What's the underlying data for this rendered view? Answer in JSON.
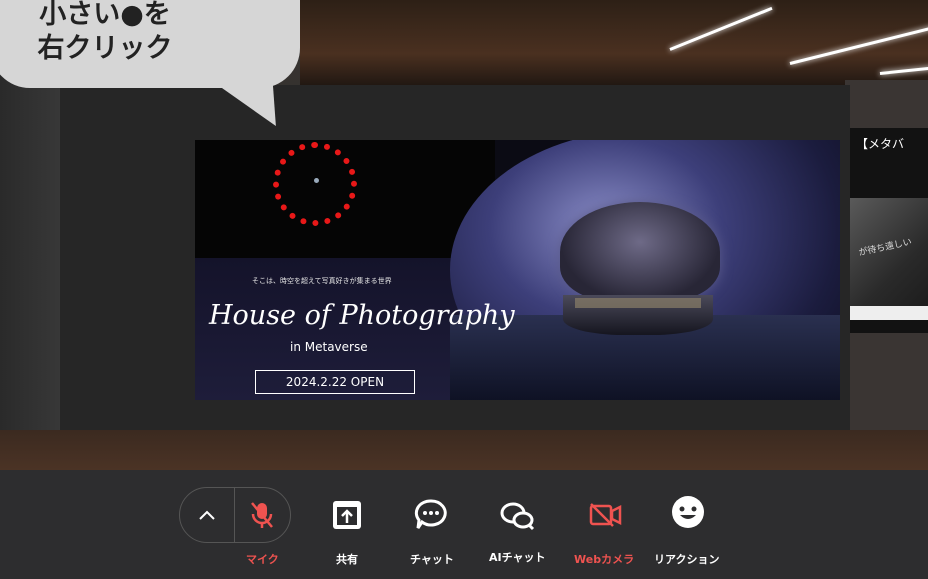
{
  "annotation": {
    "line1": "小さい●を",
    "line2": "右クリック"
  },
  "banner": {
    "tagline": "そこは、時空を超えて写真好きが集まる世界",
    "title": "House of Photography",
    "subtitle": "in Metaverse",
    "open_date": "2024.2.22 OPEN"
  },
  "side_panel": {
    "title": "【メタバ",
    "text": "が待ち遠しい"
  },
  "toolbar": {
    "buttons": [
      {
        "label": "マイク",
        "icon": "mic-muted-icon",
        "state": "off"
      },
      {
        "label": "共有",
        "icon": "share-screen-icon"
      },
      {
        "label": "チャット",
        "icon": "chat-icon"
      },
      {
        "label": "AIチャット",
        "icon": "ai-chat-icon"
      },
      {
        "label": "Webカメラ",
        "icon": "camera-off-icon",
        "state": "off"
      },
      {
        "label": "リアクション",
        "icon": "smiley-icon"
      }
    ],
    "expand_icon": "chevron-up-icon"
  },
  "colors": {
    "accent_off": "#ef5350",
    "toolbar_bg": "#2d2d2f",
    "marker": "#e81818"
  }
}
